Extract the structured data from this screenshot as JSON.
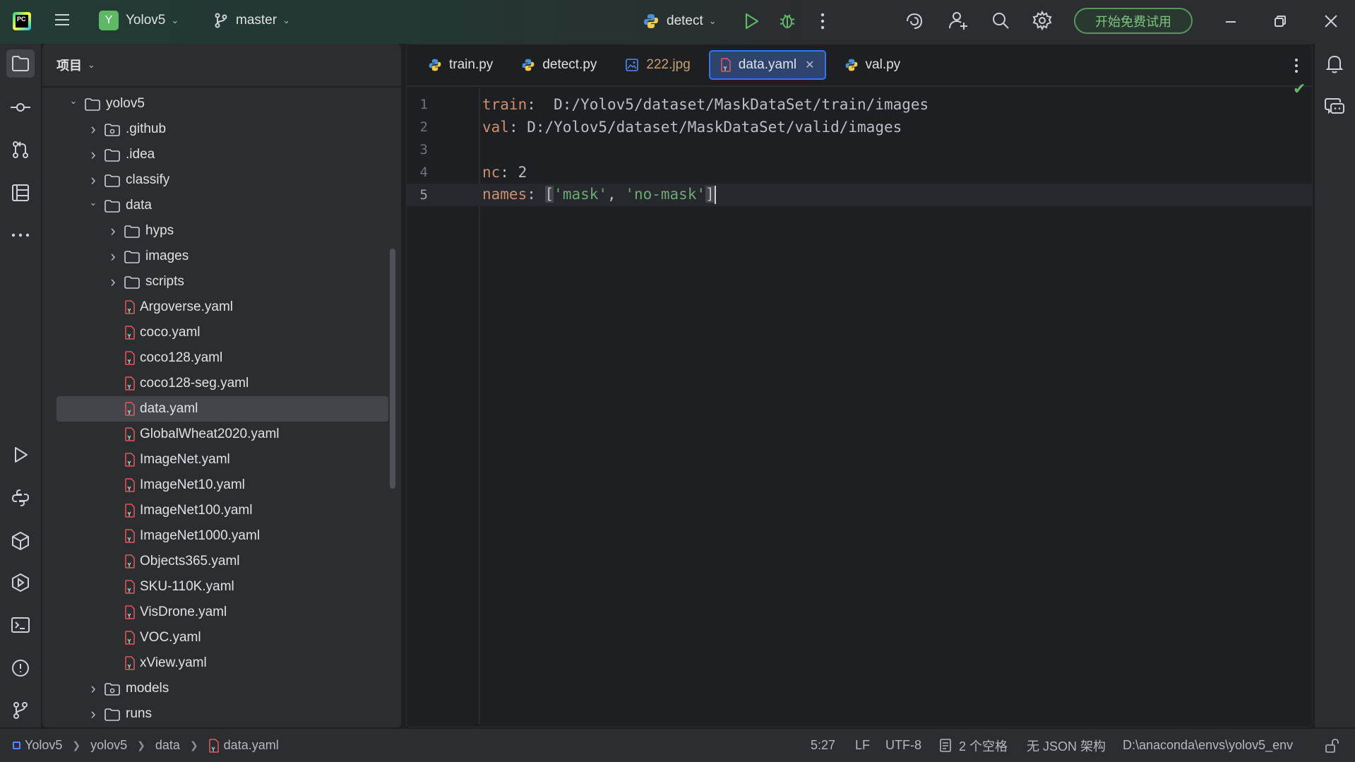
{
  "titlebar": {
    "project_badge": "Y",
    "project_name": "Yolov5",
    "branch": "master",
    "run_config": "detect",
    "trial_button": "开始免费试用",
    "icons": [
      "pycharm-logo",
      "hamburger-menu-icon",
      "branch-icon",
      "python-icon",
      "run-icon",
      "debug-icon",
      "more-vertical-icon",
      "ai-assistant-icon",
      "add-user-icon",
      "search-icon",
      "gear-icon",
      "minimize-icon",
      "restore-icon",
      "close-icon"
    ]
  },
  "left_strip": {
    "icons": [
      "folder-icon",
      "commit-icon",
      "pull-requests-icon",
      "structure-icon",
      "more-horizontal-icon",
      "run-icon",
      "python-console-icon",
      "python-packages-icon",
      "services-icon",
      "terminal-icon",
      "problems-icon",
      "git-icon"
    ]
  },
  "right_strip": {
    "icons": [
      "notifications-icon",
      "ai-chat-icon"
    ]
  },
  "project_panel": {
    "title": "项目",
    "tree": [
      {
        "label": "yolov5",
        "indent": 0,
        "arrow": "down",
        "type": "folder"
      },
      {
        "label": ".github",
        "indent": 1,
        "arrow": "right",
        "type": "folder-special"
      },
      {
        "label": ".idea",
        "indent": 1,
        "arrow": "right",
        "type": "folder"
      },
      {
        "label": "classify",
        "indent": 1,
        "arrow": "right",
        "type": "folder"
      },
      {
        "label": "data",
        "indent": 1,
        "arrow": "down",
        "type": "folder"
      },
      {
        "label": "hyps",
        "indent": 2,
        "arrow": "right",
        "type": "folder"
      },
      {
        "label": "images",
        "indent": 2,
        "arrow": "right",
        "type": "folder"
      },
      {
        "label": "scripts",
        "indent": 2,
        "arrow": "right",
        "type": "folder"
      },
      {
        "label": "Argoverse.yaml",
        "indent": 2,
        "arrow": "",
        "type": "yaml"
      },
      {
        "label": "coco.yaml",
        "indent": 2,
        "arrow": "",
        "type": "yaml"
      },
      {
        "label": "coco128.yaml",
        "indent": 2,
        "arrow": "",
        "type": "yaml"
      },
      {
        "label": "coco128-seg.yaml",
        "indent": 2,
        "arrow": "",
        "type": "yaml"
      },
      {
        "label": "data.yaml",
        "indent": 2,
        "arrow": "",
        "type": "yaml",
        "selected": true
      },
      {
        "label": "GlobalWheat2020.yaml",
        "indent": 2,
        "arrow": "",
        "type": "yaml"
      },
      {
        "label": "ImageNet.yaml",
        "indent": 2,
        "arrow": "",
        "type": "yaml"
      },
      {
        "label": "ImageNet10.yaml",
        "indent": 2,
        "arrow": "",
        "type": "yaml"
      },
      {
        "label": "ImageNet100.yaml",
        "indent": 2,
        "arrow": "",
        "type": "yaml"
      },
      {
        "label": "ImageNet1000.yaml",
        "indent": 2,
        "arrow": "",
        "type": "yaml"
      },
      {
        "label": "Objects365.yaml",
        "indent": 2,
        "arrow": "",
        "type": "yaml"
      },
      {
        "label": "SKU-110K.yaml",
        "indent": 2,
        "arrow": "",
        "type": "yaml"
      },
      {
        "label": "VisDrone.yaml",
        "indent": 2,
        "arrow": "",
        "type": "yaml"
      },
      {
        "label": "VOC.yaml",
        "indent": 2,
        "arrow": "",
        "type": "yaml"
      },
      {
        "label": "xView.yaml",
        "indent": 2,
        "arrow": "",
        "type": "yaml"
      },
      {
        "label": "models",
        "indent": 1,
        "arrow": "right",
        "type": "folder-special"
      },
      {
        "label": "runs",
        "indent": 1,
        "arrow": "right",
        "type": "folder"
      }
    ]
  },
  "editor": {
    "tabs": [
      {
        "label": "train.py",
        "icon": "python-file-icon"
      },
      {
        "label": "detect.py",
        "icon": "python-file-icon"
      },
      {
        "label": "222.jpg",
        "icon": "image-file-icon"
      },
      {
        "label": "data.yaml",
        "icon": "yaml-file-icon",
        "active": true
      },
      {
        "label": "val.py",
        "icon": "python-file-icon"
      }
    ],
    "lines": [
      {
        "num": "1",
        "key": "train",
        "sep": ":  ",
        "value": "D:/Yolov5/dataset/MaskDataSet/train/images"
      },
      {
        "num": "2",
        "key": "val",
        "sep": ": ",
        "value": "D:/Yolov5/dataset/MaskDataSet/valid/images"
      },
      {
        "num": "3",
        "key": "",
        "sep": "",
        "value": ""
      },
      {
        "num": "4",
        "key": "nc",
        "sep": ": ",
        "value": "2"
      },
      {
        "num": "5",
        "key": "names",
        "sep": ": ",
        "value": "",
        "s1": "'mask'",
        "comma": ", ",
        "s2": "'no-mask'",
        "current": true
      }
    ]
  },
  "statusbar": {
    "breadcrumbs": [
      "Yolov5",
      "yolov5",
      "data",
      "data.yaml"
    ],
    "position": "5:27",
    "line_sep": "LF",
    "encoding": "UTF-8",
    "indent": "2 个空格",
    "schema": "无 JSON 架构",
    "interpreter": "D:\\anaconda\\envs\\yolov5_env"
  },
  "colors": {
    "accent": "#3574f0",
    "keyword": "#cf8e6d",
    "string": "#6aab73",
    "trial": "#57965c"
  }
}
